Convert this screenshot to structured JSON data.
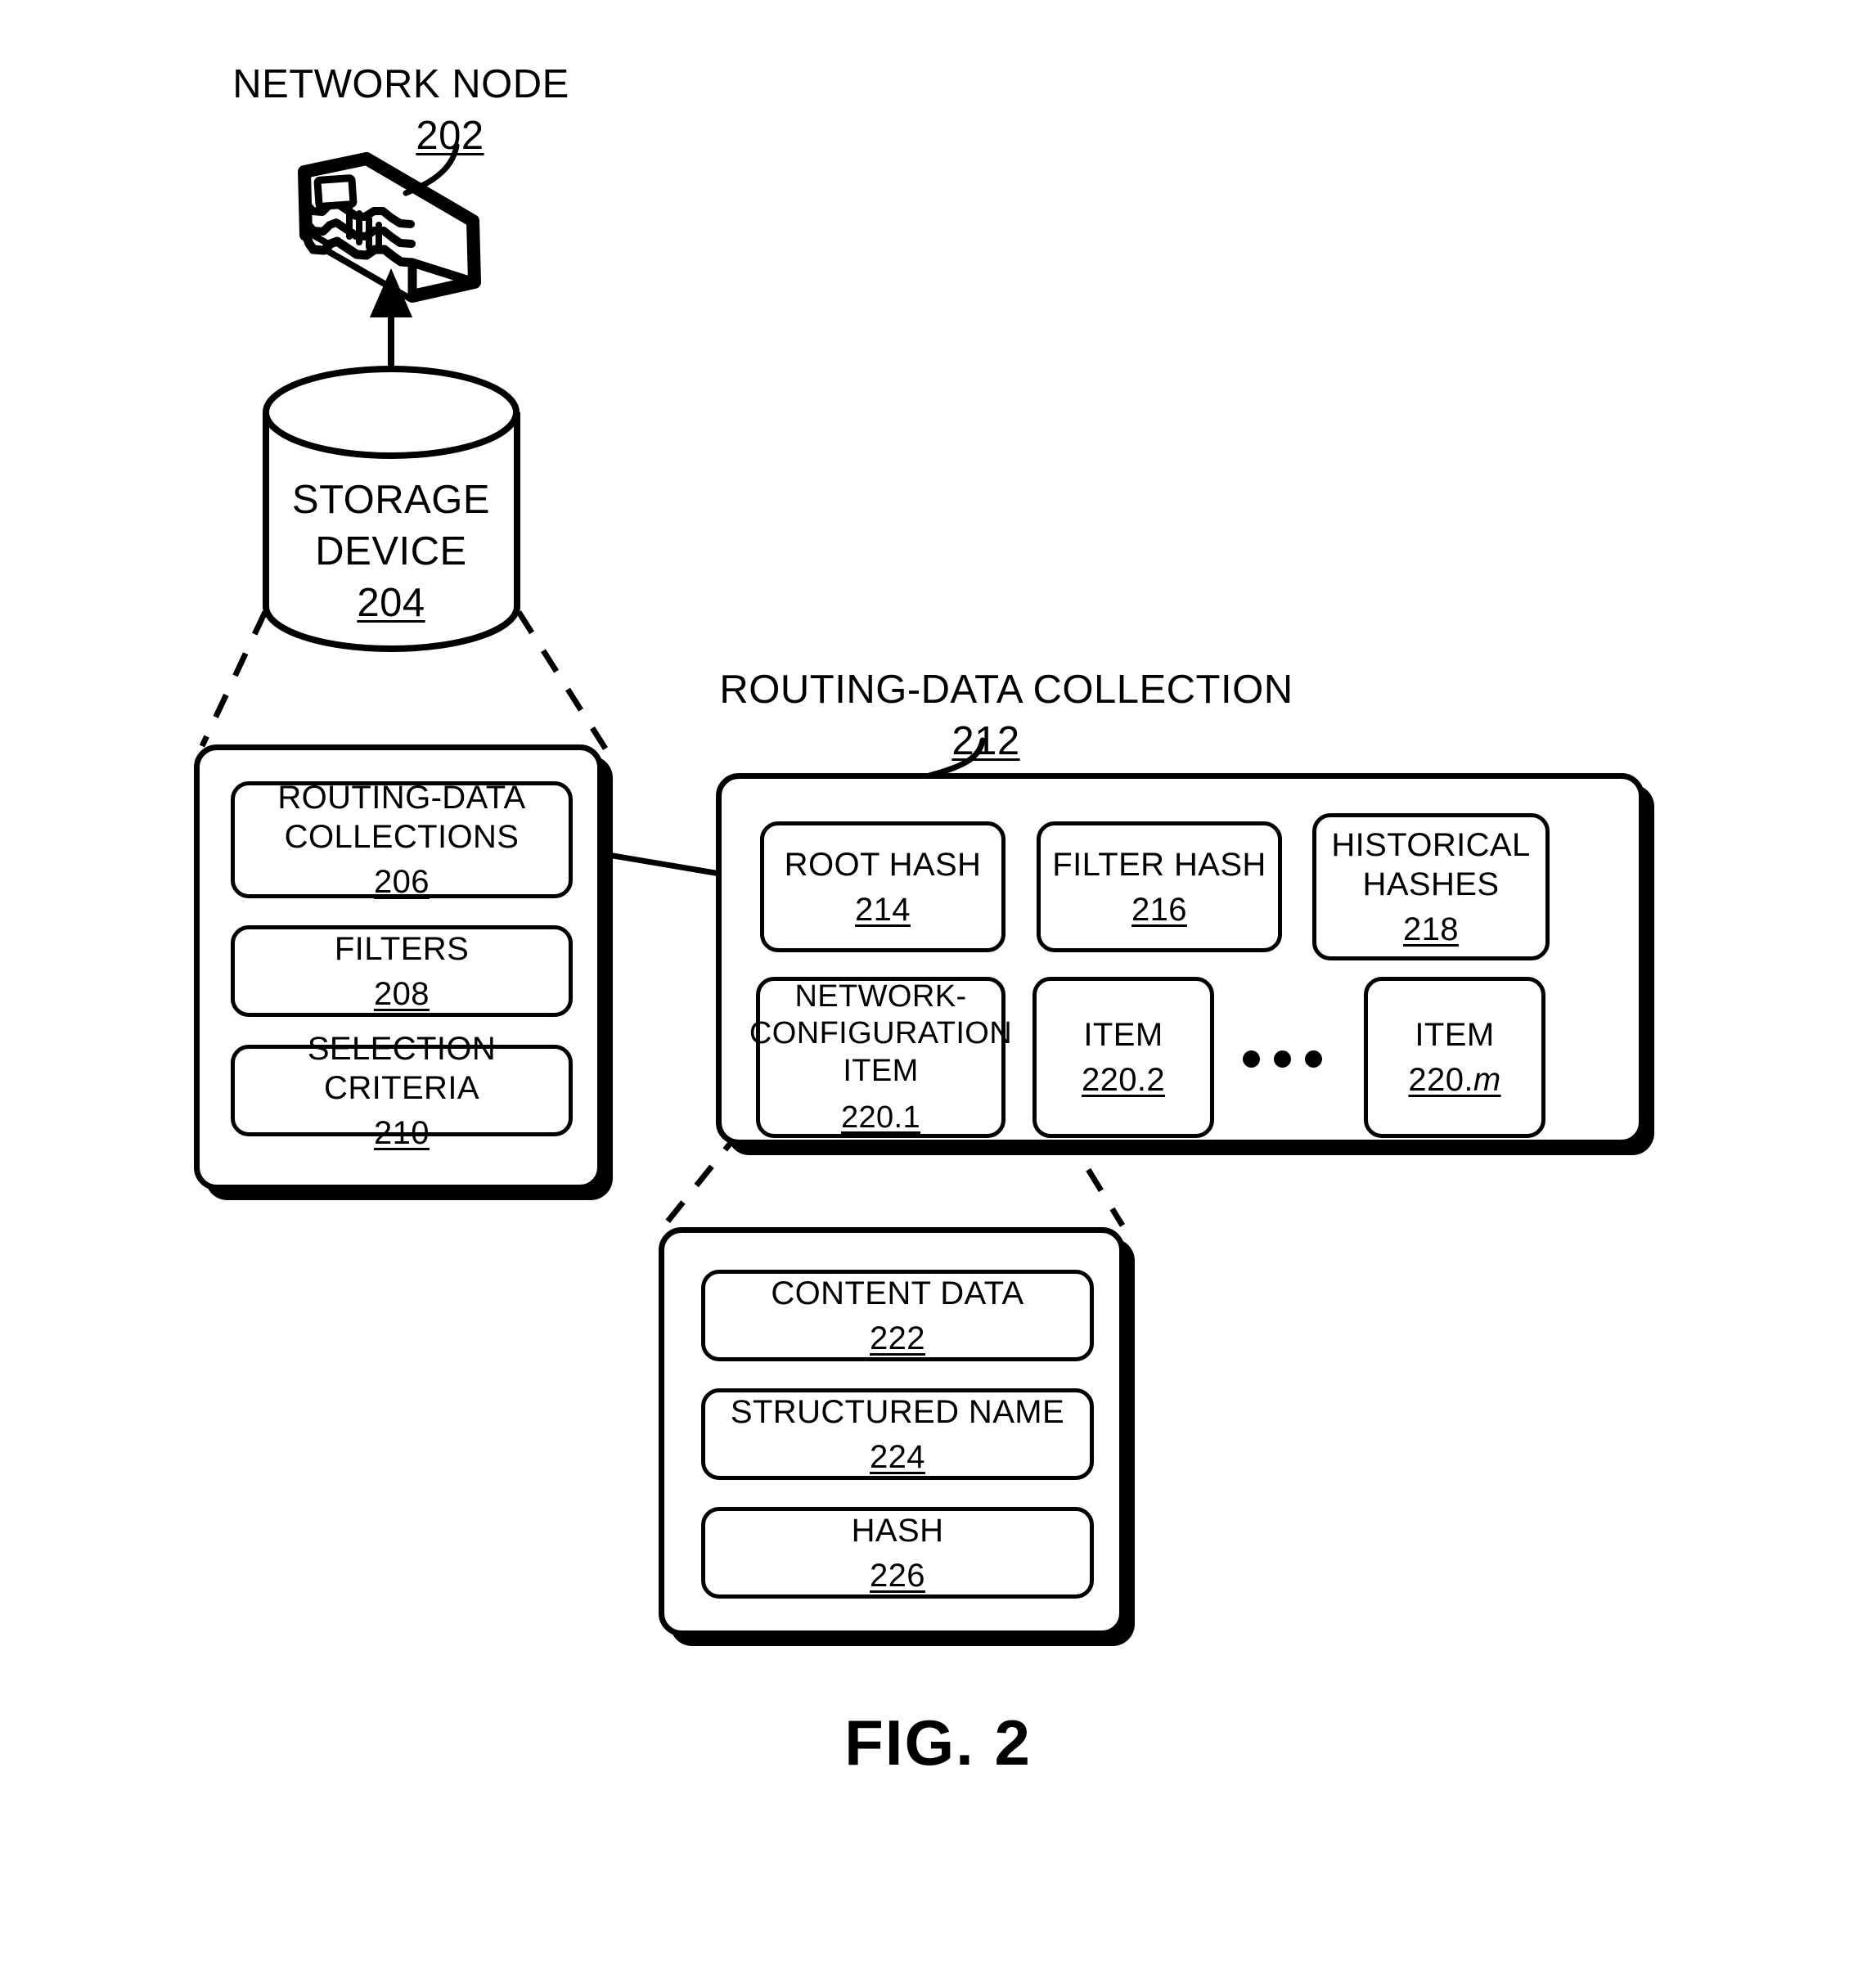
{
  "figure": {
    "caption": "FIG. 2"
  },
  "network_node": {
    "title": "NETWORK NODE",
    "ref": "202",
    "icon": "router-device-icon"
  },
  "storage_device": {
    "title_line1": "STORAGE",
    "title_line2": "DEVICE",
    "ref": "204",
    "icon": "database-cylinder-icon"
  },
  "storage_contents": {
    "items": [
      {
        "label": "ROUTING-DATA\nCOLLECTIONS",
        "ref": "206"
      },
      {
        "label": "FILTERS",
        "ref": "208"
      },
      {
        "label": "SELECTION CRITERIA",
        "ref": "210"
      }
    ]
  },
  "routing_data_collection": {
    "title": "ROUTING-DATA COLLECTION",
    "ref": "212",
    "row1": [
      {
        "label": "ROOT HASH",
        "ref": "214"
      },
      {
        "label": "FILTER HASH",
        "ref": "216"
      },
      {
        "label": "HISTORICAL\nHASHES",
        "ref": "218"
      }
    ],
    "row2": [
      {
        "label": "NETWORK-\nCONFIGURATION\nITEM",
        "ref": "220.1"
      },
      {
        "label": "ITEM",
        "ref": "220.2"
      },
      {
        "label": "ITEM",
        "ref": "220.",
        "ref_italic": "m"
      }
    ],
    "ellipsis": "•••"
  },
  "item_detail": {
    "items": [
      {
        "label": "CONTENT DATA",
        "ref": "222"
      },
      {
        "label": "STRUCTURED NAME",
        "ref": "224"
      },
      {
        "label": "HASH",
        "ref": "226"
      }
    ]
  },
  "colors": {
    "ink": "#000000",
    "paper": "#ffffff"
  }
}
